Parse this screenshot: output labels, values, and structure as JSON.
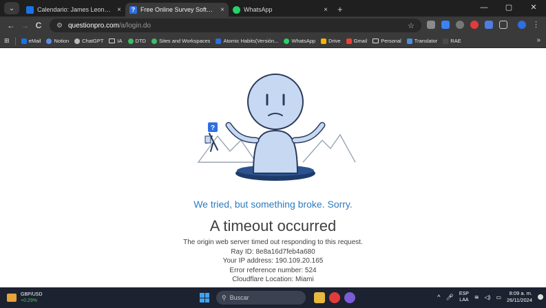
{
  "browser": {
    "tabs": [
      {
        "title": "Calendario: James Leonardo Amu...",
        "close": "×",
        "favicon_color": "#1a73e8",
        "active": false
      },
      {
        "title": "Free Online Survey Software and T...",
        "close": "×",
        "favicon_color": "#2f6fe0",
        "active": true
      },
      {
        "title": "WhatsApp",
        "close": "×",
        "favicon_color": "#25d366",
        "active": false
      }
    ],
    "new_tab": "+",
    "window_controls": {
      "minimize": "—",
      "restore": "▢",
      "close": "✕"
    },
    "nav": {
      "back": "←",
      "forward": "→",
      "reload": "C"
    },
    "address": {
      "host": "questionpro.com",
      "path": "/a/login.do"
    },
    "bookmarks": [
      {
        "label": "eMail",
        "icon": "mail-icon",
        "color": "#1a73e8"
      },
      {
        "label": "Notion",
        "icon": "notion-icon",
        "color": "#5a8de8"
      },
      {
        "label": "ChatGPT",
        "icon": "chatgpt-icon",
        "color": "#bbbbbb"
      },
      {
        "label": "IA",
        "icon": "folder-icon",
        "color": ""
      },
      {
        "label": "DTD",
        "icon": "dtd-icon",
        "color": "#3dbb6a"
      },
      {
        "label": "Sites and Workspaces",
        "icon": "sites-icon",
        "color": "#3dbb6a"
      },
      {
        "label": "Atomic Habits(Versión...",
        "icon": "atomic-icon",
        "color": "#2d6de0"
      },
      {
        "label": "WhatsApp",
        "icon": "whatsapp-icon",
        "color": "#25d366"
      },
      {
        "label": "Drive",
        "icon": "drive-icon",
        "color": "#f4b400"
      },
      {
        "label": "Gmail",
        "icon": "gmail-icon",
        "color": "#ea4335"
      },
      {
        "label": "Personal",
        "icon": "folder-icon",
        "color": ""
      },
      {
        "label": "Translator",
        "icon": "translator-icon",
        "color": "#4a90e2"
      },
      {
        "label": "RAE",
        "icon": "rae-icon",
        "color": "#4a4a4a"
      }
    ],
    "bookmarks_more": "»"
  },
  "error_page": {
    "headline": "We tried, but something broke. Sorry.",
    "title": "A timeout occurred",
    "description": "The origin web server timed out responding to this request.",
    "ray_id": "Ray ID: 8e8a16d7feb4a680",
    "ip_address": "Your IP address: 190.109.20.165",
    "error_reference": "Error reference number: 524",
    "location": "Cloudflare Location: Miami",
    "headline_color": "#2c7cc1"
  },
  "taskbar": {
    "ticker_name": "GBP/USD",
    "ticker_change": "+0.29%",
    "search_placeholder": "Buscar",
    "lang_top": "ESP",
    "lang_bottom": "LAA",
    "time": "8:09 a. m.",
    "date": "26/11/2024",
    "caret": "^"
  }
}
